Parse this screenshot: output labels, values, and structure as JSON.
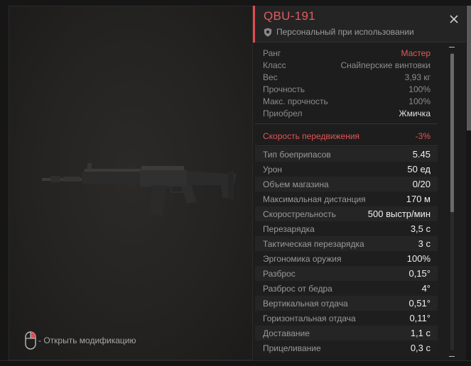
{
  "header": {
    "title": "QBU-191",
    "subtitle": "Персональный при использовании",
    "accent_color": "#e24c50"
  },
  "info": [
    {
      "key": "Ранг",
      "value": "Мастер",
      "style": "red"
    },
    {
      "key": "Класс",
      "value": "Снайперские винтовки",
      "style": "dim"
    },
    {
      "key": "Вес",
      "value": "3,93 кг",
      "style": "dim"
    },
    {
      "key": "Прочность",
      "value": "100%",
      "style": "dim"
    },
    {
      "key": "Макс. прочность",
      "value": "100%",
      "style": "dim"
    },
    {
      "key": "Приобрел",
      "value": "Жмичка",
      "style": "white"
    }
  ],
  "penalty": {
    "key": "Скорость передвижения",
    "value": "-3%"
  },
  "stats": [
    {
      "key": "Тип боеприпасов",
      "value": "5.45"
    },
    {
      "key": "Урон",
      "value": "50 ед"
    },
    {
      "key": "Объем магазина",
      "value": "0/20"
    },
    {
      "key": "Максимальная дистанция",
      "value": "170 м"
    },
    {
      "key": "Скорострельность",
      "value": "500 выстр/мин"
    },
    {
      "key": "Перезарядка",
      "value": "3,5 с"
    },
    {
      "key": "Тактическая перезарядка",
      "value": "3 с"
    },
    {
      "key": "Эргономика оружия",
      "value": "100%"
    },
    {
      "key": "Разброс",
      "value": "0,15°"
    },
    {
      "key": "Разброс от бедра",
      "value": "4°"
    },
    {
      "key": "Вертикальная отдача",
      "value": "0,51°"
    },
    {
      "key": "Горизонтальная отдача",
      "value": "0,11°"
    },
    {
      "key": "Доставание",
      "value": "1,1 с"
    },
    {
      "key": "Прицеливание",
      "value": "0,3 с"
    }
  ],
  "hint": {
    "text": "- Открыть модификацию",
    "icon": "mouse-right-click-icon"
  },
  "icons": {
    "close": "close-icon",
    "shield": "shield-icon"
  },
  "scroll": {
    "position_fraction": 0.0,
    "visible_fraction": 0.53
  }
}
